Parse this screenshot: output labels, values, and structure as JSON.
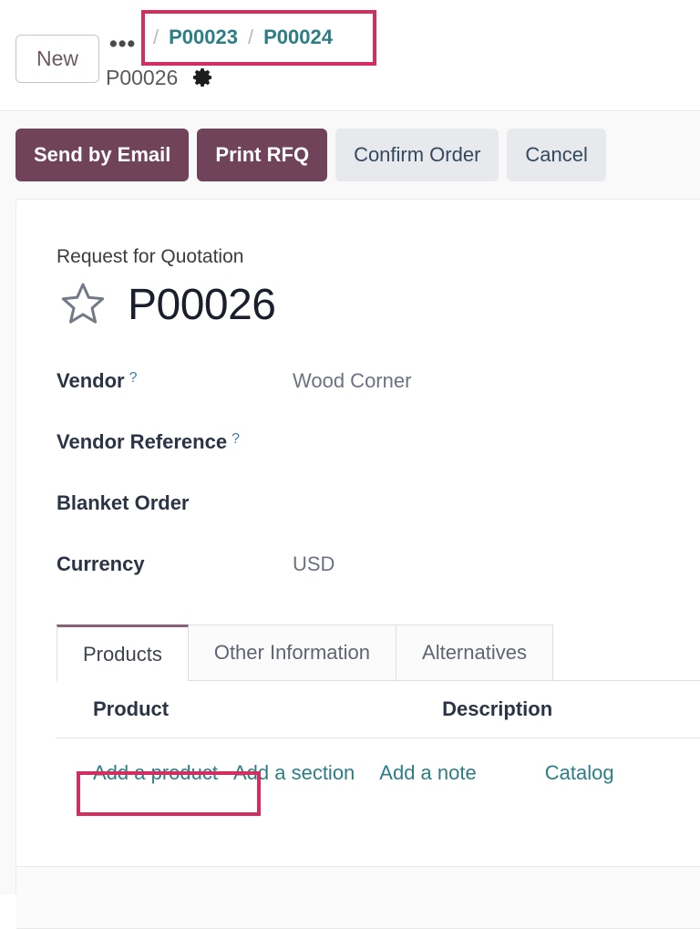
{
  "topbar": {
    "new_button": "New",
    "ellipsis": "•••",
    "separator": "/",
    "breadcrumb_links": [
      "P00023",
      "P00024"
    ],
    "current_record": "P00026",
    "gear_icon_name": "gear-icon",
    "highlight_color": "#d22e62",
    "link_color": "#2c7e86"
  },
  "actionbar": {
    "buttons": [
      {
        "label": "Send by Email",
        "style": "primary"
      },
      {
        "label": "Print RFQ",
        "style": "primary"
      },
      {
        "label": "Confirm Order",
        "style": "secondary"
      },
      {
        "label": "Cancel",
        "style": "secondary"
      }
    ],
    "primary_color": "#71435a",
    "secondary_color": "#e7e9ed"
  },
  "sheet": {
    "form_caption": "Request for Quotation",
    "title": "P00026",
    "star_icon_name": "star-outline-icon",
    "fields": [
      {
        "label": "Vendor",
        "tip": "?",
        "value": "Wood Corner"
      },
      {
        "label": "Vendor Reference",
        "tip": "?",
        "value": ""
      },
      {
        "label": "Blanket Order",
        "tip": "",
        "value": ""
      },
      {
        "label": "Currency",
        "tip": "",
        "value": "USD"
      }
    ],
    "tabs": [
      {
        "label": "Products",
        "active": true
      },
      {
        "label": "Other Information",
        "active": false
      },
      {
        "label": "Alternatives",
        "active": false
      }
    ],
    "table": {
      "columns": [
        "Product",
        "Description"
      ],
      "rows": [],
      "add_links": [
        "Add a product",
        "Add a section",
        "Add a note"
      ],
      "catalog_link": "Catalog"
    }
  }
}
